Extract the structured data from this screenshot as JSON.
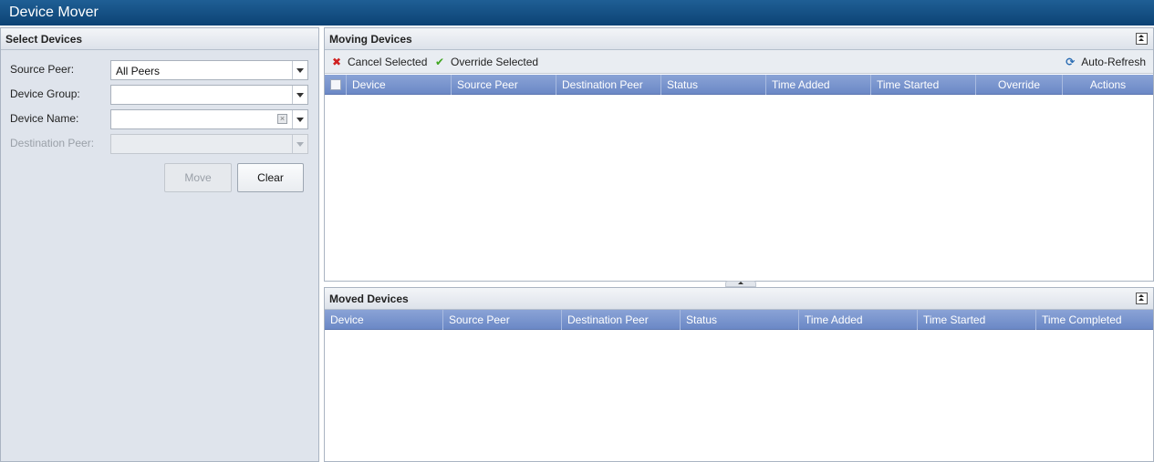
{
  "app": {
    "title": "Device Mover"
  },
  "select_panel": {
    "title": "Select Devices",
    "source_peer": {
      "label": "Source Peer:",
      "value": "All Peers"
    },
    "device_group": {
      "label": "Device Group:",
      "value": ""
    },
    "device_name": {
      "label": "Device Name:",
      "value": ""
    },
    "destination_peer": {
      "label": "Destination Peer:",
      "value": ""
    },
    "move_label": "Move",
    "clear_label": "Clear"
  },
  "moving_panel": {
    "title": "Moving Devices",
    "cancel_label": "Cancel Selected",
    "override_label": "Override Selected",
    "autorefresh_label": "Auto-Refresh",
    "columns": [
      "Device",
      "Source Peer",
      "Destination Peer",
      "Status",
      "Time Added",
      "Time Started",
      "Override",
      "Actions"
    ],
    "rows": []
  },
  "moved_panel": {
    "title": "Moved Devices",
    "columns": [
      "Device",
      "Source Peer",
      "Destination Peer",
      "Status",
      "Time Added",
      "Time Started",
      "Time Completed"
    ],
    "rows": []
  },
  "icons": {
    "cancel": "x-icon",
    "override": "checkmark-icon",
    "refresh": "refresh-icon",
    "collapse": "collapse-up-icon"
  },
  "colors": {
    "titlebar": "#0c4274",
    "grid_header": "#6b88c6",
    "panel_bg": "#dfe4ec",
    "cancel_icon": "#cf2020",
    "override_icon": "#3fa51f"
  }
}
